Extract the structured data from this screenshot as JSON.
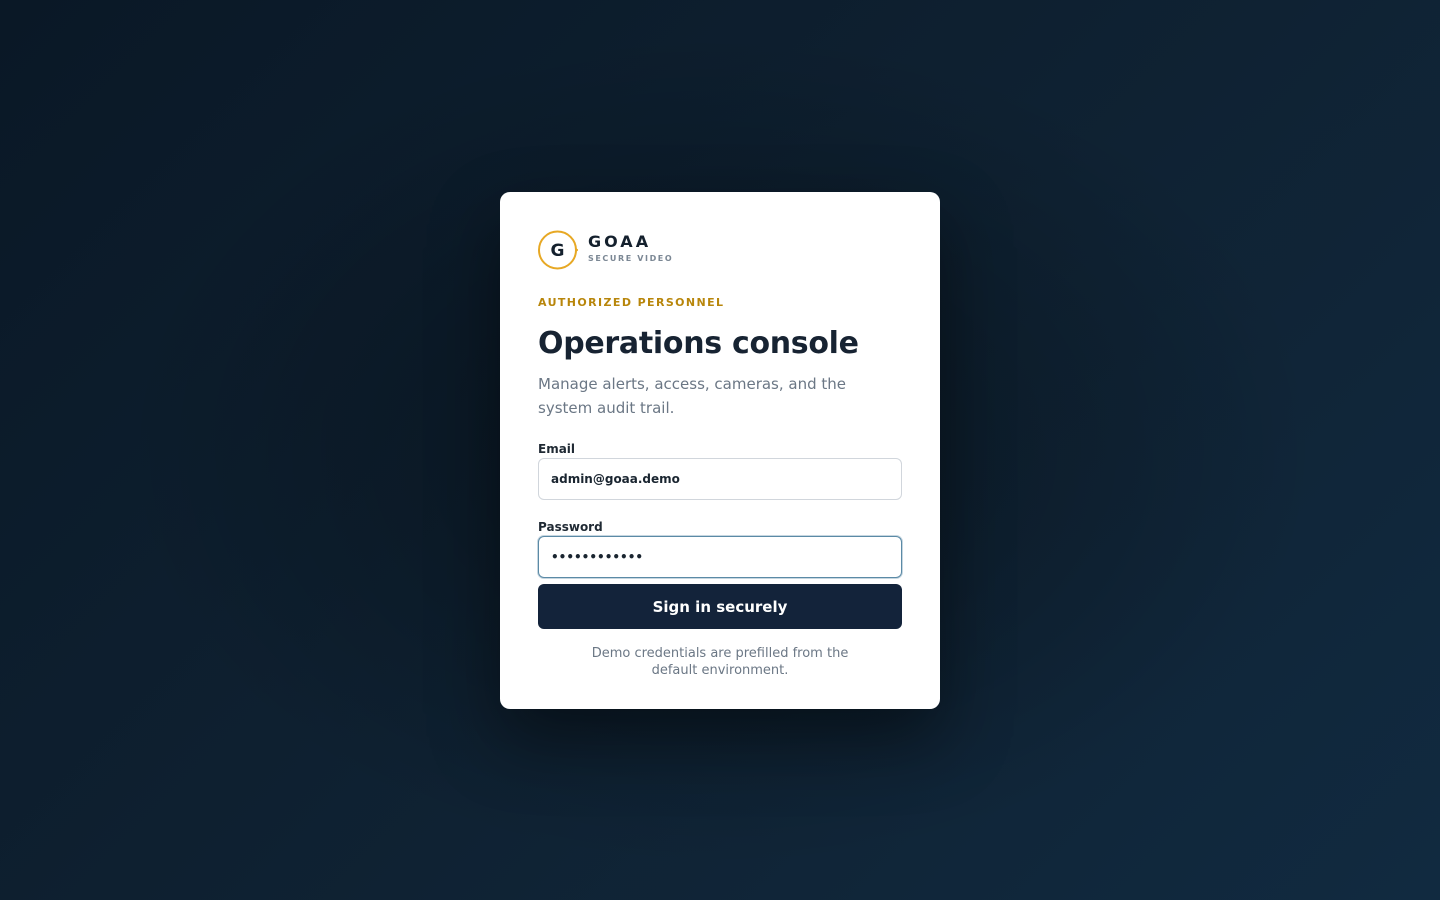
{
  "brand": {
    "logo_letter": "G",
    "name": "GOAA",
    "tagline": "SECURE VIDEO",
    "accent_color": "#e7a824"
  },
  "login": {
    "eyebrow": "AUTHORIZED PERSONNEL",
    "title": "Operations console",
    "subtitle": "Manage alerts, access, cameras, and the system audit trail.",
    "email_label": "Email",
    "email_value": "admin@goaa.demo",
    "password_label": "Password",
    "password_value": "••••••••••••",
    "submit_label": "Sign in securely",
    "footnote": "Demo credentials are prefilled from the default environment."
  },
  "colors": {
    "eyebrow": "#b8860b",
    "button": "#13233a",
    "background": "#0f2233"
  }
}
